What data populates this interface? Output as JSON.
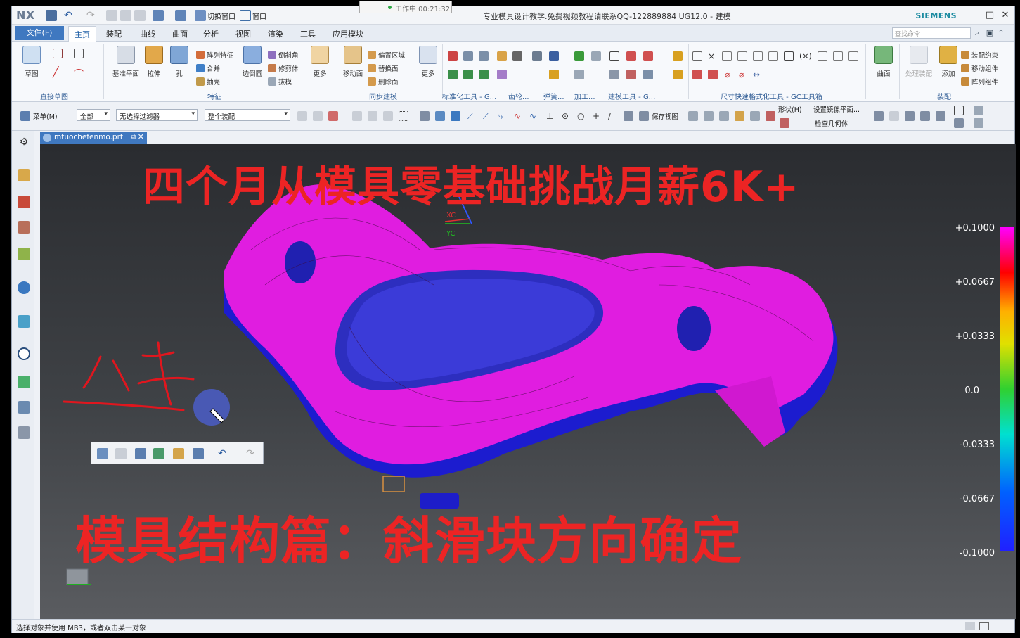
{
  "app": {
    "logo": "NX",
    "window_title": "专业模具设计教学.免费视频教程请联系QQ-122889884 UG12.0 - 建模",
    "brand": "SIEMENS",
    "timer_popup": "工作中 00:21:32"
  },
  "menu": {
    "file": "文件(F)",
    "tabs": [
      "主页",
      "装配",
      "曲线",
      "曲面",
      "分析",
      "视图",
      "渲染",
      "工具",
      "应用模块"
    ],
    "active_tab": "主页",
    "search_placeholder": "查找命令",
    "quick_switch": "切换窗口",
    "window": "窗口"
  },
  "ribbon": {
    "direct_sketch": {
      "label": "直接草图",
      "sketch": "草图"
    },
    "feature": {
      "label": "特征",
      "datum_plane": "基准平面",
      "extrude": "拉伸",
      "hole": "孔",
      "pattern": "阵列特征",
      "unite": "合并",
      "shell": "抽壳",
      "edge_blend": "边倒圆",
      "chamfer": "倒斜角",
      "trim_body": "修剪体",
      "draft": "拔模",
      "more": "更多"
    },
    "sync": {
      "label": "同步建模",
      "move_face": "移动面",
      "offset_region": "偏置区域",
      "replace_face": "替换面",
      "delete_face": "删除面",
      "more": "更多"
    },
    "std_tools": "标准化工具 - G...",
    "gear": "齿轮...",
    "spring": "弹簧...",
    "machining": "加工...",
    "modeling_tools": "建模工具 - G...",
    "dim_tools": "尺寸快速格式化工具 - GC工具箱",
    "surface": {
      "label": "曲面"
    },
    "assembly": {
      "label": "装配",
      "handle_assembly": "处理装配",
      "add": "添加",
      "constraint": "装配约束",
      "move_component": "移动组件",
      "pattern_component": "阵列组件"
    }
  },
  "selection_bar": {
    "menu": "菜单(M)",
    "filter1": "全部",
    "filter2": "无选择过滤器",
    "scope": "整个装配",
    "save_view": "保存视图",
    "shape": "形状(H)",
    "set_mirror_plane": "设置镜像平面...",
    "check_geometry": "检查几何体"
  },
  "file_tab": {
    "name": "mtuochefenmo.prt"
  },
  "viewport": {
    "headline": "四个月从模具零基础挑战月薪6K+",
    "subline": "模具结构篇：斜滑块方向确定",
    "axis_xc": "XC",
    "axis_yc": "YC",
    "legend": [
      "+0.1000",
      "+0.0667",
      "+0.0333",
      "0.0",
      "-0.0333",
      "-0.0667",
      "-0.1000"
    ]
  },
  "status": {
    "message": "选择对象并使用 MB3，或者双击某一对象"
  },
  "colors": {
    "accent": "#3f78c0",
    "headline": "#ec2424",
    "part_face": "#e020e0",
    "part_underside": "#1a1ad0"
  }
}
